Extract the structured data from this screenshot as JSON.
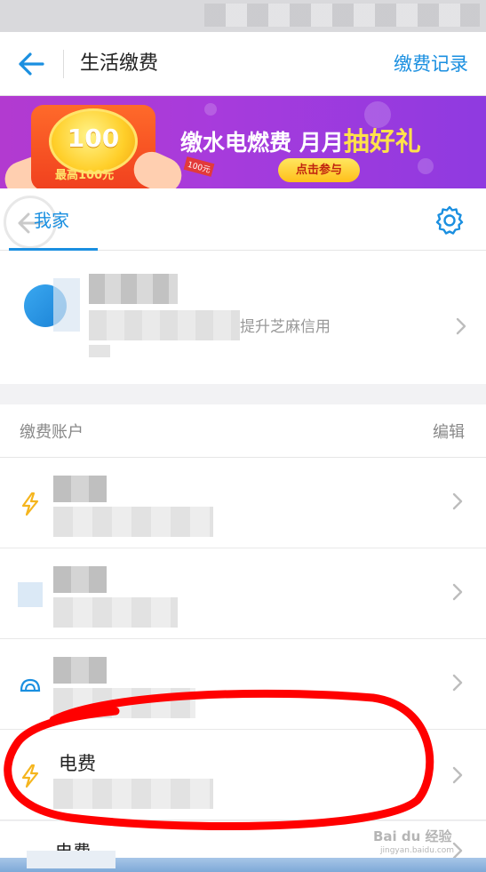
{
  "header": {
    "title": "生活缴费",
    "records_link": "缴费记录"
  },
  "banner": {
    "coin_value": "100",
    "max_label": "最高100元",
    "slogan_part1": "缴水电燃费 月月",
    "slogan_highlight": "抽好礼",
    "join_button": "点击参与",
    "tag": "100元"
  },
  "home": {
    "tab_label": "我家",
    "credit_text": "提升芝麻信用"
  },
  "accounts": {
    "section_title": "缴费账户",
    "edit_label": "编辑",
    "rows": [
      {
        "icon": "lightning-icon",
        "label": ""
      },
      {
        "icon": "water-drop-icon",
        "label": ""
      },
      {
        "icon": "gas-flame-icon",
        "label": ""
      },
      {
        "icon": "lightning-icon",
        "label": "电费"
      },
      {
        "icon": "",
        "label": "电费"
      }
    ]
  },
  "colors": {
    "accent": "#1a8fe0",
    "electric_icon": "#f5b51e",
    "annotation_red": "#ff0000"
  }
}
